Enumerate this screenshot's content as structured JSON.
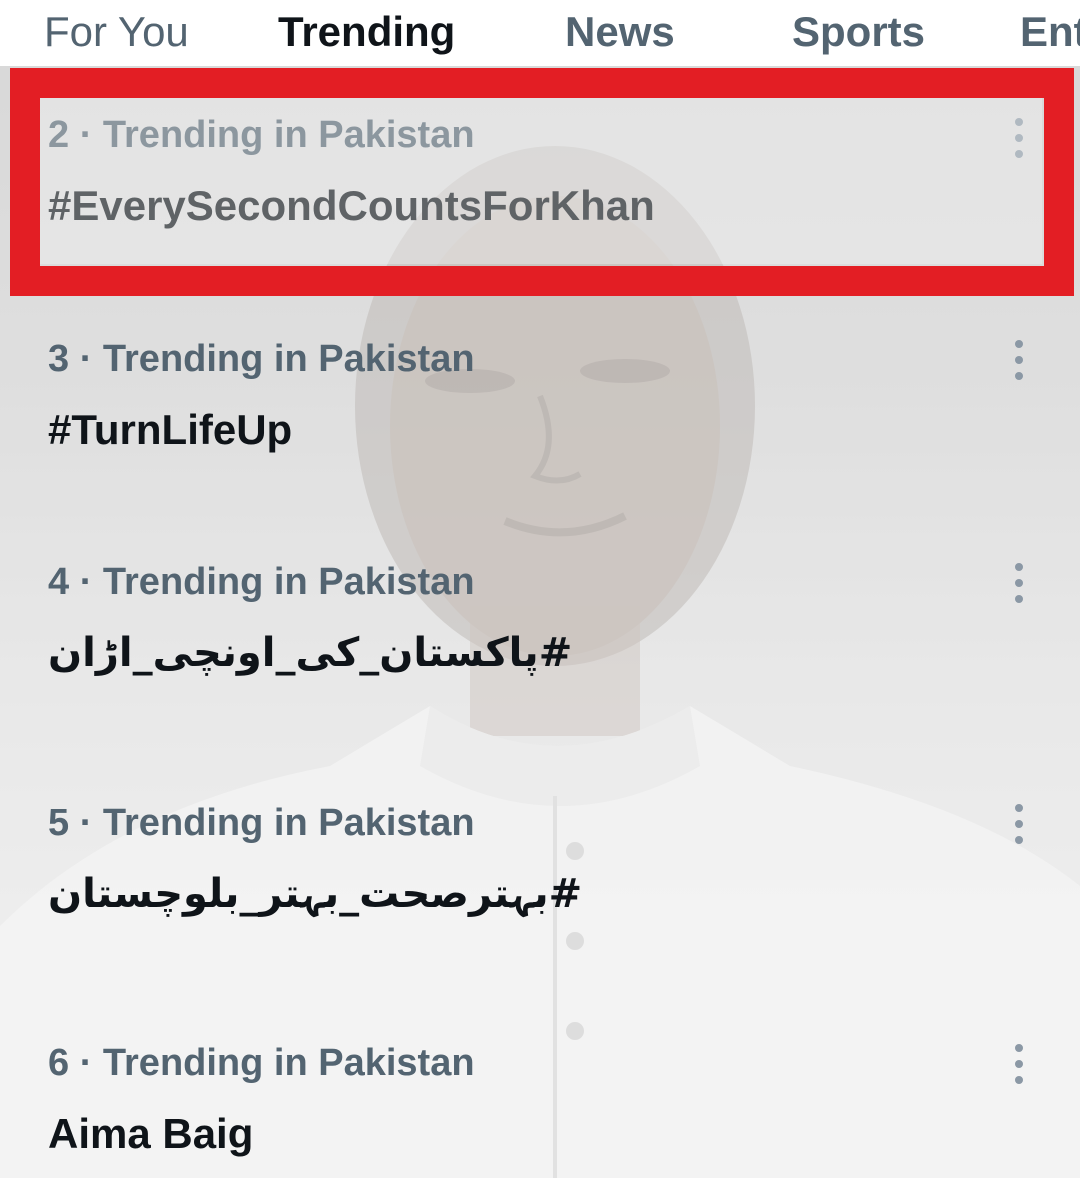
{
  "tabs": [
    {
      "label": "For You",
      "active": false
    },
    {
      "label": "Trending",
      "active": true
    },
    {
      "label": "News",
      "active": false
    },
    {
      "label": "Sports",
      "active": false
    },
    {
      "label": "Ent",
      "active": false
    }
  ],
  "trends": [
    {
      "meta": "2 · Trending in Pakistan",
      "title": "#EverySecondCountsForKhan",
      "highlighted": true
    },
    {
      "meta": "3 · Trending in Pakistan",
      "title": "#TurnLifeUp"
    },
    {
      "meta": "4 · Trending in Pakistan",
      "title": "#پاکستان_کی_اونچی_اڑان"
    },
    {
      "meta": "5 · Trending in Pakistan",
      "title": "#بہترصحت_بہتر_بلوچستان"
    },
    {
      "meta": "6 · Trending in Pakistan",
      "title": "Aima Baig"
    }
  ],
  "icons": {
    "more": "more-vertical-icon"
  },
  "colors": {
    "highlight": "#e31e24",
    "primary_text": "#0f1419",
    "secondary_text": "#536471"
  }
}
